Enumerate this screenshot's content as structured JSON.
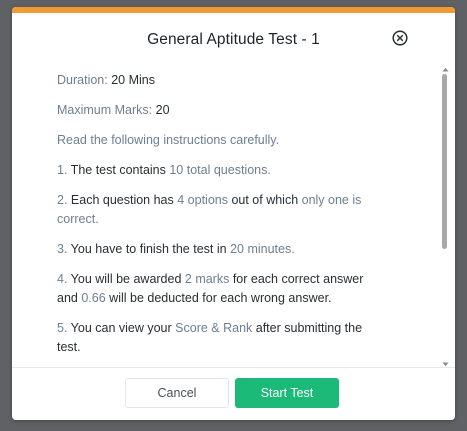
{
  "colors": {
    "accent_bar": "#f49a34",
    "start_button": "#1bba78",
    "muted_label": "#6e7f90"
  },
  "modal": {
    "title": "General Aptitude Test - 1",
    "close_icon": "close-circle-icon"
  },
  "info": {
    "duration_label": "Duration:",
    "duration_value": " 20 Mins",
    "max_marks_label": "Maximum Marks:",
    "max_marks_value": " 20",
    "instructions_heading": "Read the following instructions carefully."
  },
  "instructions": [
    {
      "num": "1.",
      "t1": " The test contains ",
      "h1": "10 total questions.",
      "t2": "",
      "h2": "",
      "t3": ""
    },
    {
      "num": "2.",
      "t1": " Each question has ",
      "h1": "4 options",
      "t2": " out of which ",
      "h2": "only one is correct.",
      "t3": ""
    },
    {
      "num": "3.",
      "t1": " You have to finish the test in ",
      "h1": "20 minutes.",
      "t2": "",
      "h2": "",
      "t3": ""
    },
    {
      "num": "4.",
      "t1": " You will be awarded ",
      "h1": "2 marks",
      "t2": " for each correct answer and ",
      "h2": "0.66",
      "t3": " will be deducted for each wrong answer."
    },
    {
      "num": "5.",
      "t1": " You can view your ",
      "h1": "Score & Rank",
      "t2": " after submitting the test.",
      "h2": "",
      "t3": ""
    }
  ],
  "footer": {
    "cancel_label": "Cancel",
    "start_label": "Start Test"
  }
}
